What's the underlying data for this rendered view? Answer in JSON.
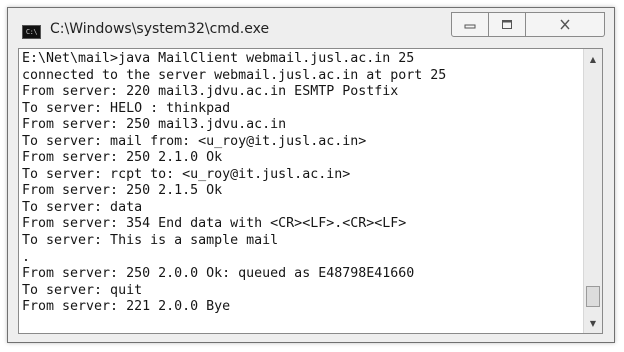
{
  "window": {
    "title": "C:\\Windows\\system32\\cmd.exe",
    "icon": "cmd-icon",
    "icon_text": "C:\\"
  },
  "controls": {
    "minimize_icon": "minimize-icon",
    "maximize_icon": "maximize-icon",
    "close_icon": "close-icon"
  },
  "console": {
    "lines": [
      "E:\\Net\\mail>java MailClient webmail.jusl.ac.in 25",
      "connected to the server webmail.jusl.ac.in at port 25",
      "From server: 220 mail3.jdvu.ac.in ESMTP Postfix",
      "To server: HELO : thinkpad",
      "From server: 250 mail3.jdvu.ac.in",
      "To server: mail from: <u_roy@it.jusl.ac.in>",
      "From server: 250 2.1.0 Ok",
      "To server: rcpt to: <u_roy@it.jusl.ac.in>",
      "From server: 250 2.1.5 Ok",
      "To server: data",
      "From server: 354 End data with <CR><LF>.<CR><LF>",
      "To server: This is a sample mail",
      ".",
      "From server: 250 2.0.0 Ok: queued as E48798E41660",
      "To server: quit",
      "From server: 221 2.0.0 Bye"
    ]
  },
  "scrollbar": {
    "up_icon": "scroll-up-arrow-icon",
    "down_icon": "scroll-down-arrow-icon",
    "position": 0.92
  }
}
